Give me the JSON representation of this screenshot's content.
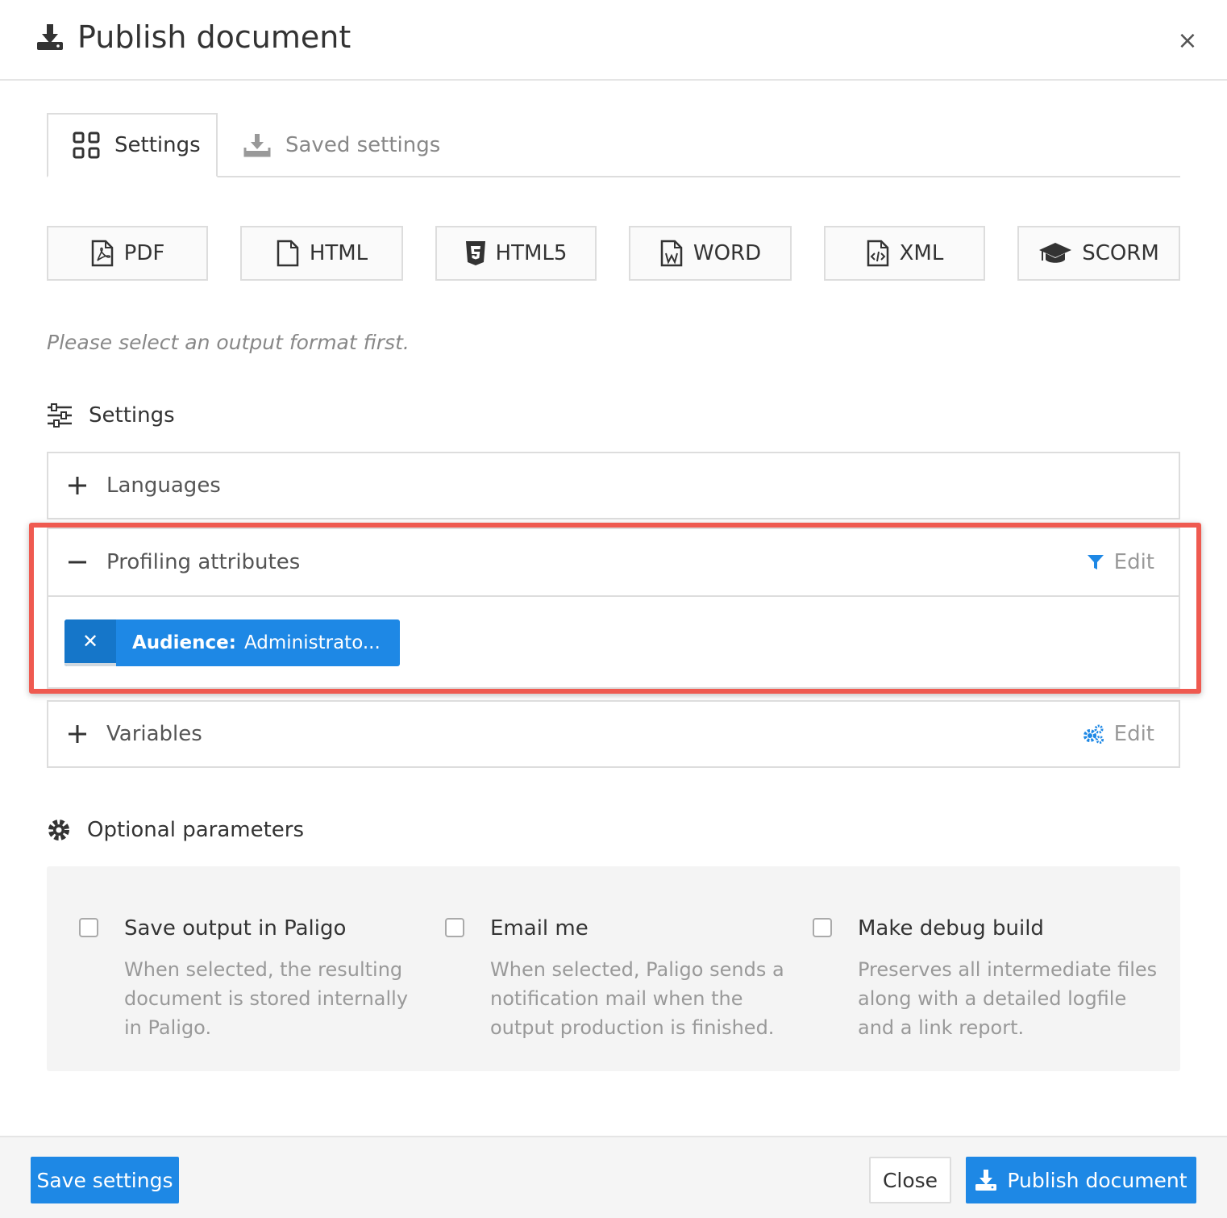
{
  "dialog": {
    "title": "Publish document",
    "close_icon": "close-icon"
  },
  "tabs": [
    {
      "label": "Settings",
      "icon": "grid-icon",
      "active": true
    },
    {
      "label": "Saved settings",
      "icon": "download-tray-icon",
      "active": false
    }
  ],
  "formats": [
    {
      "label": "PDF",
      "icon": "pdf-file-icon"
    },
    {
      "label": "HTML",
      "icon": "file-icon"
    },
    {
      "label": "HTML5",
      "icon": "html5-icon"
    },
    {
      "label": "WORD",
      "icon": "word-file-icon"
    },
    {
      "label": "XML",
      "icon": "code-file-icon"
    },
    {
      "label": "SCORM",
      "icon": "graduation-cap-icon"
    }
  ],
  "hint": "Please select an output format first.",
  "settings": {
    "heading": "Settings",
    "languages_label": "Languages",
    "profiling": {
      "label": "Profiling attributes",
      "edit_label": "Edit",
      "chip_key": "Audience:",
      "chip_value": "Administrato..."
    },
    "variables": {
      "label": "Variables",
      "edit_label": "Edit"
    }
  },
  "optional": {
    "heading": "Optional parameters",
    "options": [
      {
        "title": "Save output in Paligo",
        "desc": "When selected, the resulting document is stored internally in Paligo.",
        "checked": false
      },
      {
        "title": "Email me",
        "desc": "When selected, Paligo sends a notification mail when the output production is finished.",
        "checked": false
      },
      {
        "title": "Make debug build",
        "desc": "Preserves all intermediate files along with a detailed logfile and a link report.",
        "checked": false
      }
    ]
  },
  "footer": {
    "save_label": "Save settings",
    "close_label": "Close",
    "publish_label": "Publish document"
  },
  "colors": {
    "accent": "#1e88e5",
    "highlight": "#ef5a50"
  }
}
